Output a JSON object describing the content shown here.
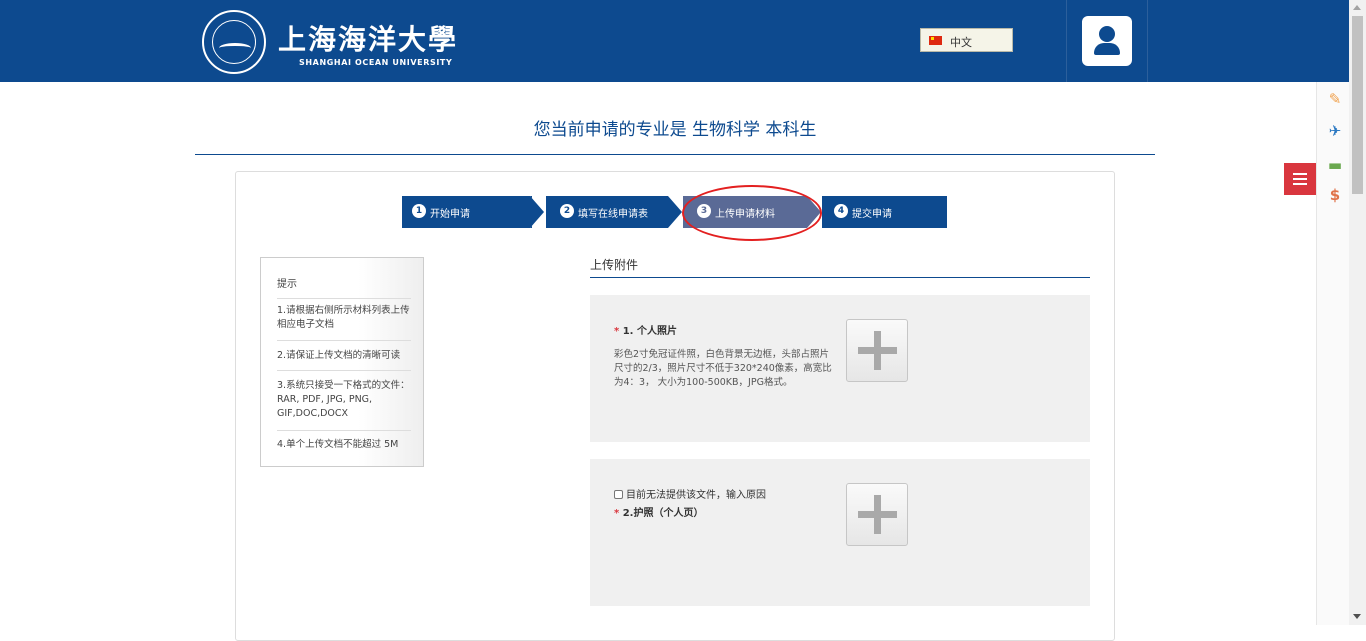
{
  "header": {
    "university_name_cn": "上海海洋大學",
    "university_name_en": "SHANGHAI OCEAN UNIVERSITY",
    "brand_color": "#0d4a8f",
    "language": {
      "label": "中文",
      "flag_icon": "china-flag-icon"
    }
  },
  "page": {
    "title": "您当前申请的专业是 生物科学 本科生"
  },
  "steps": [
    {
      "num": "1",
      "label": "开始申请"
    },
    {
      "num": "2",
      "label": "填写在线申请表"
    },
    {
      "num": "3",
      "label": "上传申请材料",
      "active": true
    },
    {
      "num": "4",
      "label": "提交申请"
    }
  ],
  "tips": {
    "title": "提示",
    "items": [
      "1.请根据右侧所示材料列表上传相应电子文档",
      "2.请保证上传文档的清晰可读",
      "3.系统只接受一下格式的文件：RAR, PDF, JPG, PNG, GIF,DOC,DOCX",
      "4.单个上传文档不能超过 5M"
    ]
  },
  "upload": {
    "heading": "上传附件",
    "items": [
      {
        "required_mark": "*",
        "label": "1. 个人照片",
        "description": "彩色2寸免冠证件照，白色背景无边框，头部占照片尺寸的2/3，照片尺寸不低于320*240像素，高宽比为4：3， 大小为100-500KB，JPG格式。"
      },
      {
        "checkbox_label": "目前无法提供该文件，输入原因",
        "required_mark": "*",
        "label": "2.护照（个人页）"
      }
    ]
  },
  "sidebar_icons": [
    "edit-icon",
    "plane-icon",
    "bed-icon",
    "dollar-icon"
  ],
  "sidebar_glyphs": {
    "edit": "✎",
    "plane": "✈",
    "bed": "▬",
    "dollar": "$"
  }
}
